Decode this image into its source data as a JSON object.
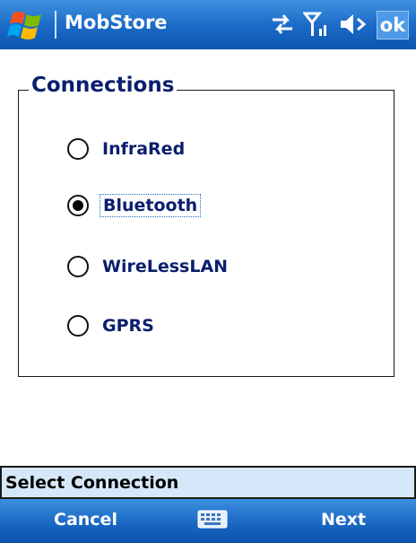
{
  "titlebar": {
    "app_title": "MobStore",
    "ok_label": "ok"
  },
  "icons": {
    "start": "windows-start-flag-icon",
    "connectivity": "sync-arrows-icon",
    "signal": "signal-strength-icon",
    "volume": "speaker-volume-icon",
    "keyboard": "input-panel-keyboard-icon"
  },
  "group": {
    "title": "Connections",
    "options": [
      {
        "label": "InfraRed",
        "selected": false
      },
      {
        "label": "Bluetooth",
        "selected": true
      },
      {
        "label": "WireLessLAN",
        "selected": false
      },
      {
        "label": "GPRS",
        "selected": false
      }
    ]
  },
  "status": {
    "text": "Select Connection"
  },
  "menubar": {
    "left_softkey": "Cancel",
    "right_softkey": "Next"
  },
  "colors": {
    "titlebar_blue": "#1c6cc8",
    "label_navy": "#0a1f6e",
    "status_bg": "#d5e7f8"
  }
}
